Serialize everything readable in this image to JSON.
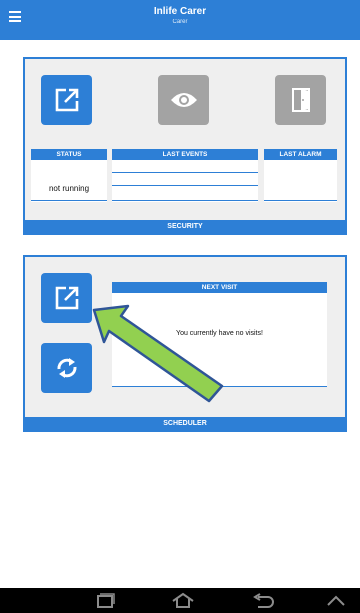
{
  "header": {
    "title": "Inlife Carer",
    "subtitle": "Carer"
  },
  "security": {
    "footer_label": "SECURITY",
    "tiles": {
      "open": "open-external-icon",
      "view": "eye-icon",
      "door": "door-icon"
    },
    "columns": {
      "status_label": "STATUS",
      "last_events_label": "LAST EVENTS",
      "last_alarm_label": "LAST ALARM"
    },
    "status_value": "not running"
  },
  "scheduler": {
    "footer_label": "SCHEDULER",
    "tiles": {
      "open": "open-external-icon",
      "sync": "sync-icon"
    },
    "next_visit_label": "NEXT VISIT",
    "next_visit_message": "You currently have no visits!"
  },
  "annotation": {
    "arrow_color": "#92d050",
    "arrow_icon": "pointer-arrow-icon"
  },
  "nav": {
    "icons": [
      "recent-apps-icon",
      "home-icon",
      "back-icon",
      "up-chevron-icon"
    ]
  },
  "colors": {
    "accent": "#2d7fd6",
    "tile_gray": "#a3a3a3",
    "panel_bg": "#efefef"
  }
}
